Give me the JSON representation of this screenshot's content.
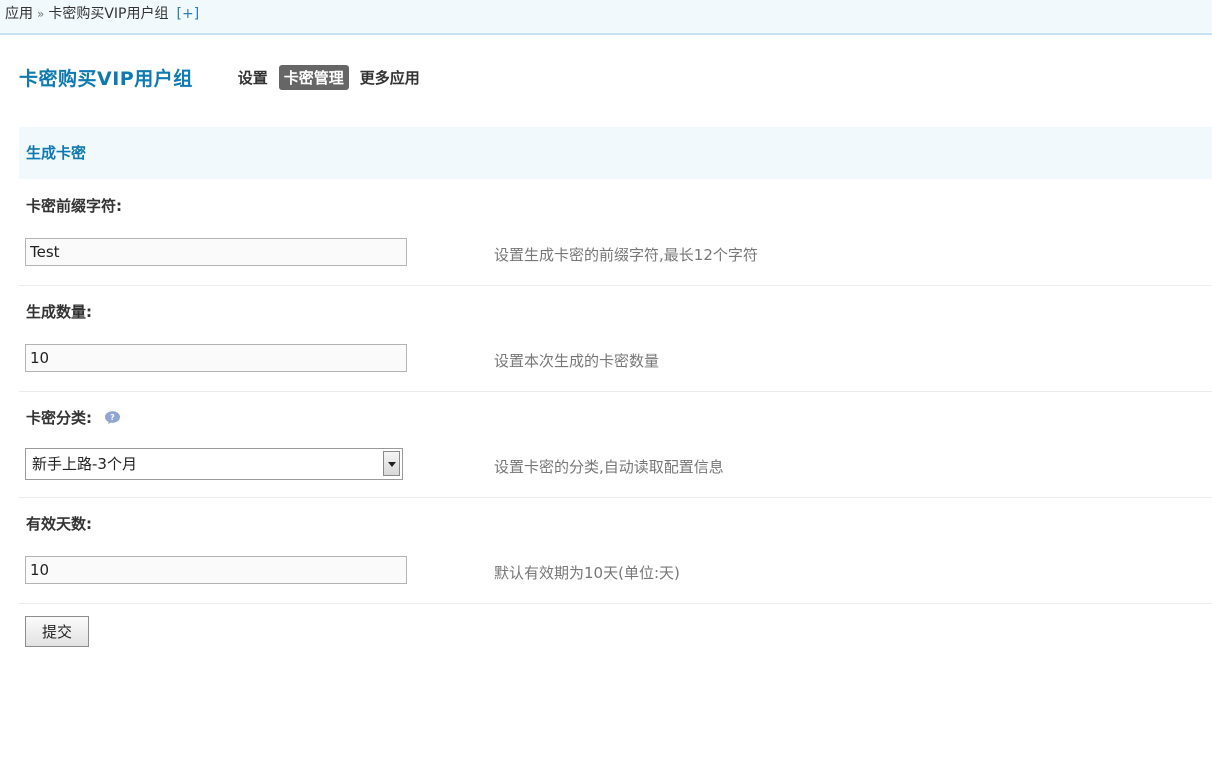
{
  "breadcrumb": {
    "root": "应用",
    "separator": "»",
    "current": "卡密购买VIP用户组",
    "add": "[+]"
  },
  "header": {
    "app_title": "卡密购买VIP用户组",
    "tabs": [
      {
        "label": "设置",
        "active": false
      },
      {
        "label": "卡密管理",
        "active": true
      },
      {
        "label": "更多应用",
        "active": false
      }
    ]
  },
  "section": {
    "title": "生成卡密"
  },
  "form": {
    "prefix": {
      "label": "卡密前缀字符:",
      "value": "Test",
      "hint": "设置生成卡密的前缀字符,最长12个字符"
    },
    "quantity": {
      "label": "生成数量:",
      "value": "10",
      "hint": "设置本次生成的卡密数量"
    },
    "category": {
      "label": "卡密分类:",
      "selected": "新手上路-3个月",
      "hint": "设置卡密的分类,自动读取配置信息"
    },
    "days": {
      "label": "有效天数:",
      "value": "10",
      "hint": "默认有效期为10天(单位:天)"
    },
    "submit_label": "提交"
  },
  "colors": {
    "accent": "#0f7ab1",
    "active_tab_bg": "#666666",
    "section_bg": "#f2f9fd"
  },
  "icons": {
    "help": "question-bubble-icon",
    "dropdown": "chevron-down-icon"
  }
}
